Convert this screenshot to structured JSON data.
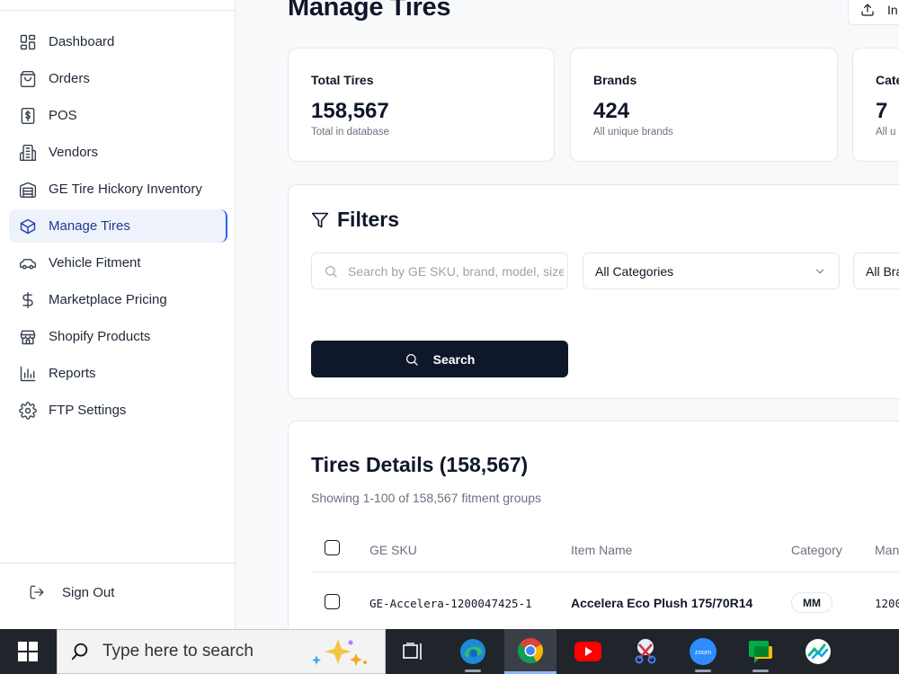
{
  "sidebar": {
    "items": [
      {
        "label": "Dashboard",
        "icon": "dashboard-grid-icon"
      },
      {
        "label": "Orders",
        "icon": "shopping-bag-icon"
      },
      {
        "label": "POS",
        "icon": "dollar-receipt-icon"
      },
      {
        "label": "Vendors",
        "icon": "building-icon"
      },
      {
        "label": "GE Tire Hickory Inventory",
        "icon": "warehouse-icon"
      },
      {
        "label": "Manage Tires",
        "icon": "package-box-icon",
        "active": true
      },
      {
        "label": "Vehicle Fitment",
        "icon": "car-icon"
      },
      {
        "label": "Marketplace Pricing",
        "icon": "dollar-sign-icon"
      },
      {
        "label": "Shopify Products",
        "icon": "store-icon"
      },
      {
        "label": "Reports",
        "icon": "bar-chart-icon"
      },
      {
        "label": "FTP Settings",
        "icon": "gear-icon"
      }
    ],
    "sign_out": "Sign Out"
  },
  "header": {
    "title": "Manage Tires",
    "import_label": "In"
  },
  "stats": [
    {
      "label": "Total Tires",
      "value": "158,567",
      "sub": "Total in database"
    },
    {
      "label": "Brands",
      "value": "424",
      "sub": "All unique brands"
    },
    {
      "label": "Cate",
      "value": "7",
      "sub": "All u"
    }
  ],
  "filters": {
    "title": "Filters",
    "search_placeholder": "Search by GE SKU, brand, model, size",
    "category_value": "All Categories",
    "brand_value": "All Bra",
    "search_button": "Search"
  },
  "details": {
    "title": "Tires Details (158,567)",
    "subtitle": "Showing 1-100 of 158,567 fitment groups",
    "columns": [
      "GE SKU",
      "Item Name",
      "Category",
      "Man"
    ],
    "rows": [
      {
        "sku": "GE-Accelera-1200047425-1",
        "name": "Accelera Eco Plush 175/70R14",
        "category": "MM",
        "man": "1200"
      }
    ]
  },
  "taskbar": {
    "search_text": "Type here to search",
    "apps": [
      "task-view-icon",
      "edge-icon",
      "chrome-icon",
      "youtube-icon",
      "snipping-tool-icon",
      "zoom-icon",
      "google-chat-icon",
      "trading-app-icon"
    ],
    "zoom_label": "zoom"
  },
  "colors": {
    "accent": "#1e40af",
    "primary_button": "#0f172a",
    "taskbar": "#20242b"
  }
}
